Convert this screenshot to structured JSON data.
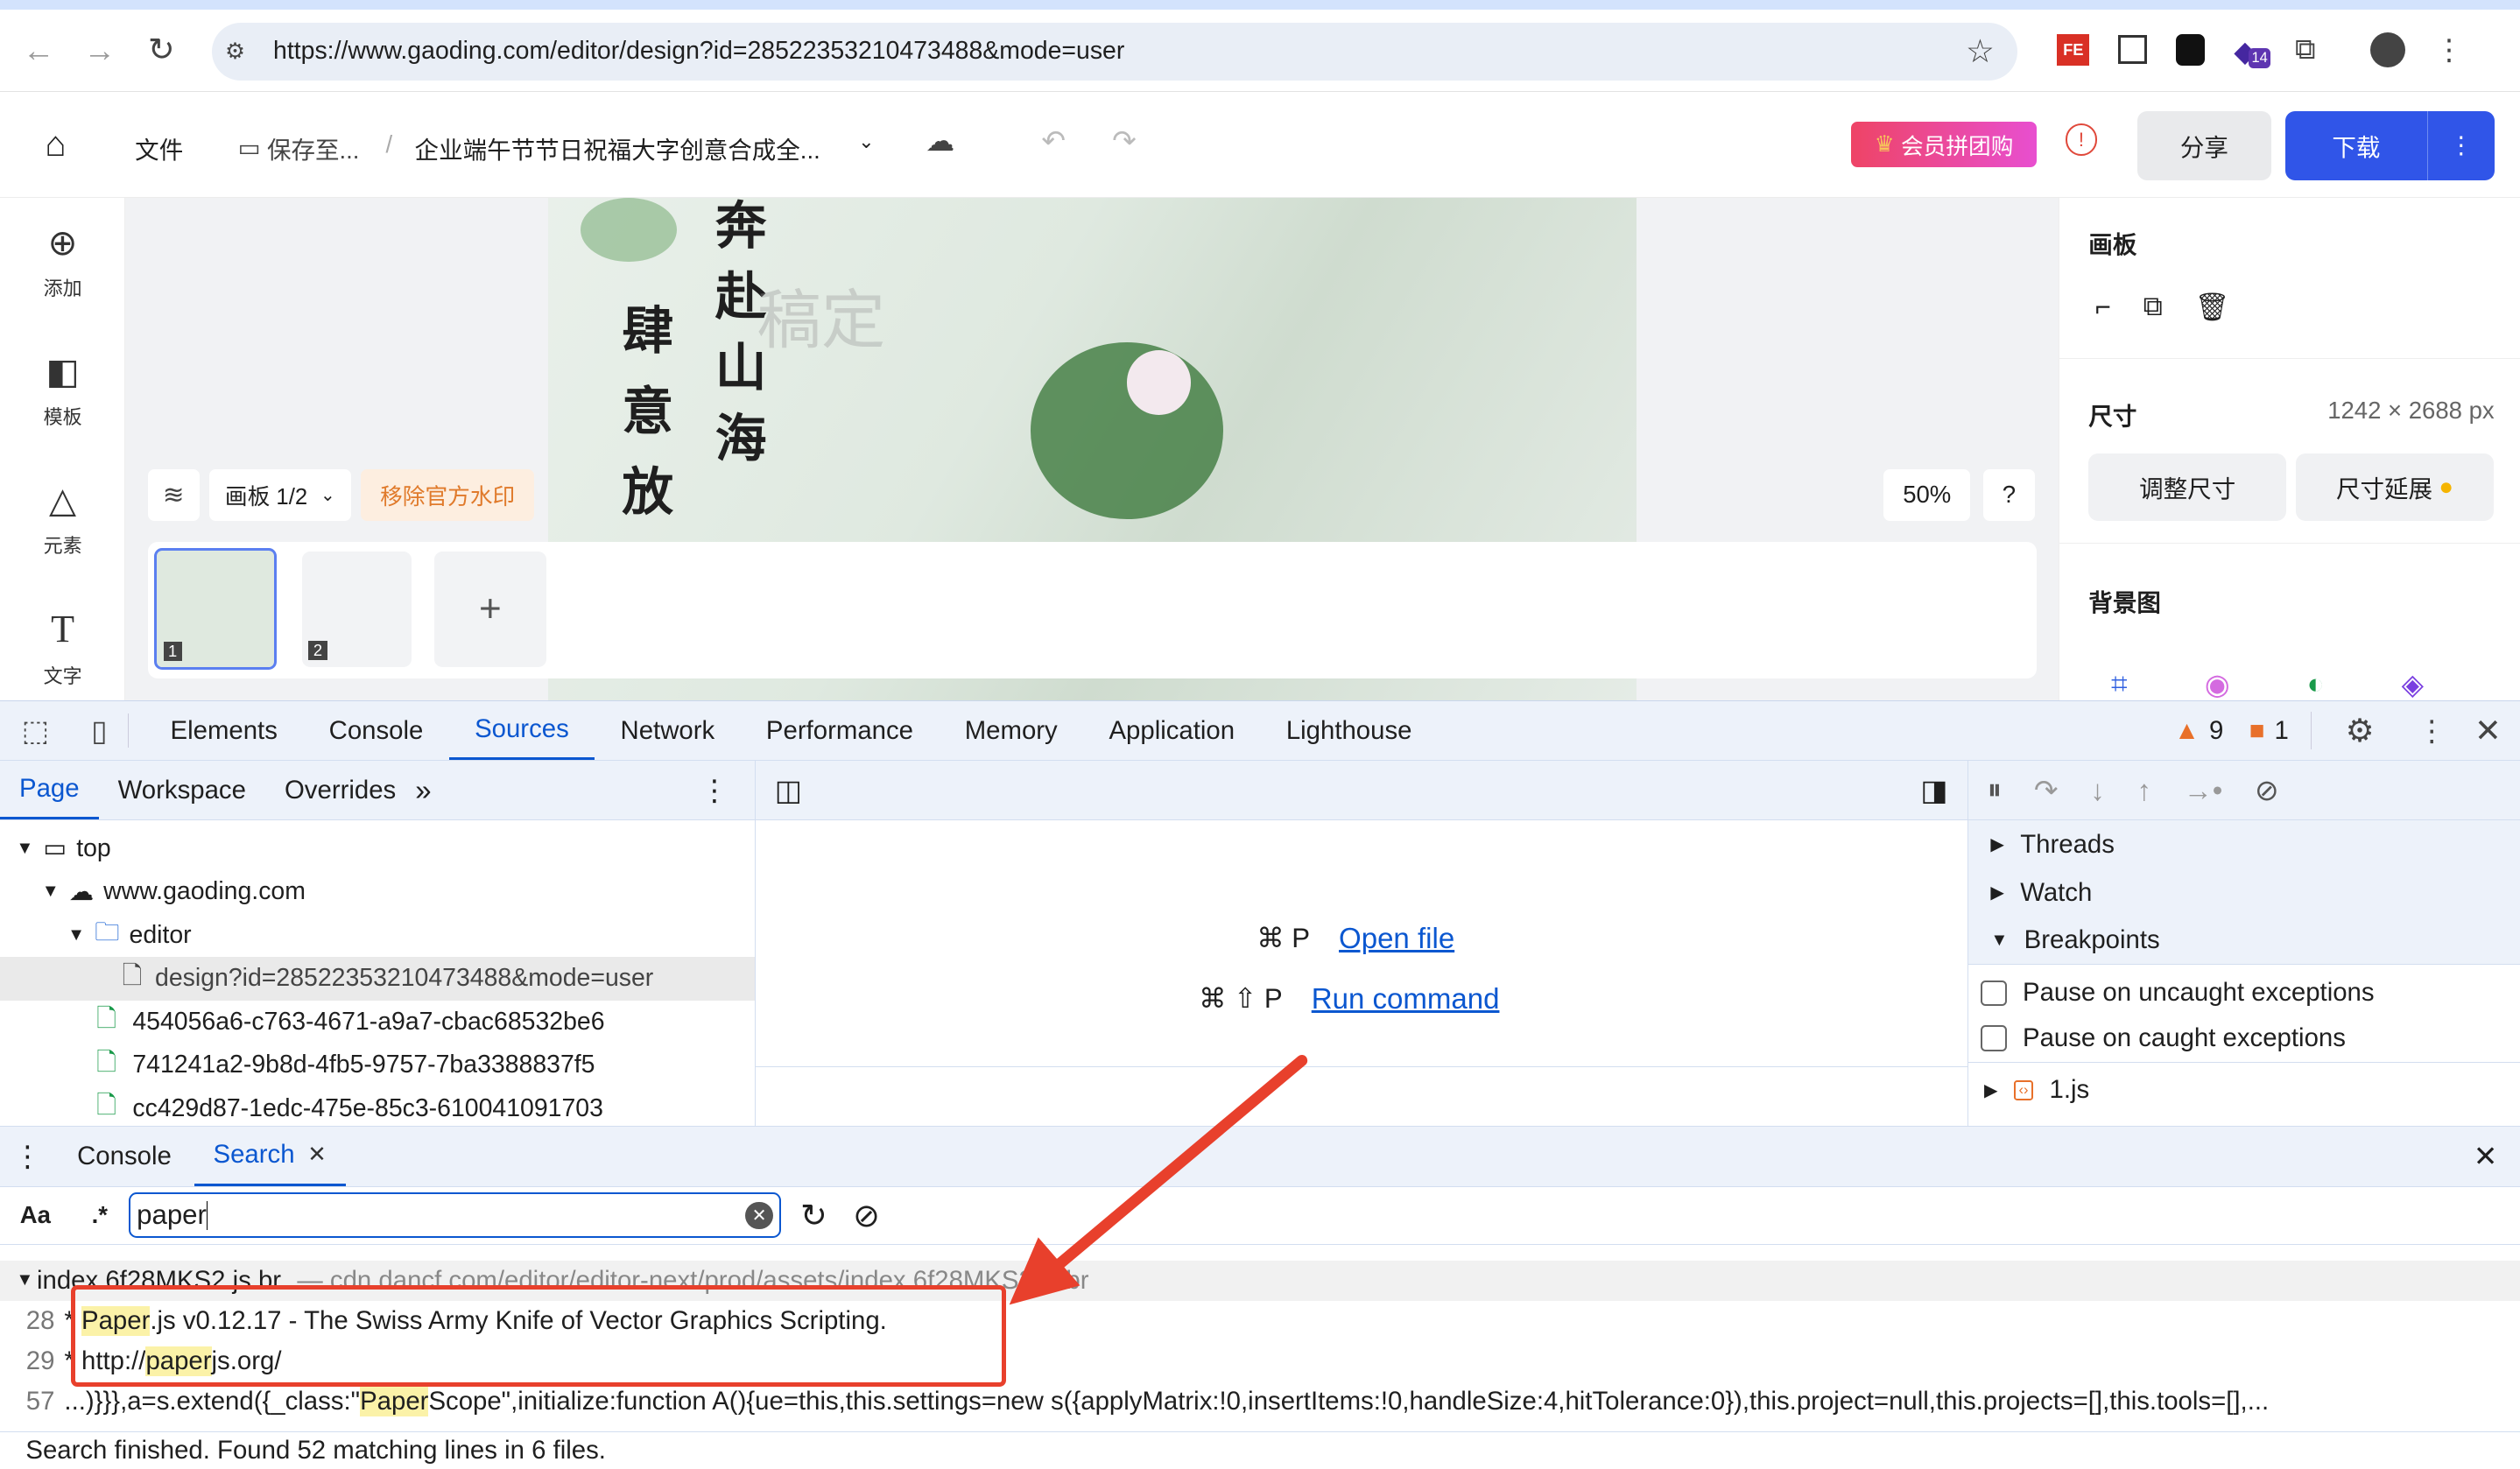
{
  "browser": {
    "url": "https://www.gaoding.com/editor/design?id=28522353210473488&mode=user",
    "ext_badge": "14"
  },
  "app": {
    "file_menu": "文件",
    "save_to": "保存至...",
    "separator": "/",
    "doc_title": "企业端午节节日祝福大字创意合成全...",
    "vip_button": "会员拼团购",
    "share": "分享",
    "download": "下载"
  },
  "sidebar": {
    "items": [
      {
        "label": "添加",
        "icon": "plus-circle-icon"
      },
      {
        "label": "模板",
        "icon": "template-icon"
      },
      {
        "label": "元素",
        "icon": "shapes-icon"
      },
      {
        "label": "文字",
        "icon": "text-icon"
      }
    ]
  },
  "canvas": {
    "board_label": "画板 1/2",
    "remove_watermark": "移除官方水印",
    "zoom": "50%",
    "help": "?",
    "poster_text": [
      "奔",
      "赴",
      "山",
      "海",
      "肆",
      "意",
      "放"
    ],
    "watermark": "稿定",
    "thumbnails": [
      "1",
      "2"
    ],
    "add": "+"
  },
  "right_panel": {
    "section_board": "画板",
    "size_label": "尺寸",
    "size_value": "1242 × 2688 px",
    "resize": "调整尺寸",
    "extend": "尺寸延展",
    "background": "背景图"
  },
  "devtools": {
    "tabs": [
      "Elements",
      "Console",
      "Sources",
      "Network",
      "Performance",
      "Memory",
      "Application",
      "Lighthouse"
    ],
    "active_tab": "Sources",
    "warnings": "9",
    "errors": "1",
    "nav_tabs": [
      "Page",
      "Workspace",
      "Overrides"
    ],
    "tree": [
      "top",
      "www.gaoding.com",
      "editor",
      "design?id=28522353210473488&mode=user",
      "454056a6-c763-4671-a9a7-cbac68532be6",
      "741241a2-9b8d-4fb5-9757-7ba3388837f5",
      "cc429d87-1edc-475e-85c3-610041091703"
    ],
    "editor": {
      "open_shortcut": "⌘ P",
      "open_file": "Open file",
      "run_shortcut": "⌘ ⇧ P",
      "run_command": "Run command"
    },
    "debugger": {
      "sections": [
        "Threads",
        "Watch",
        "Breakpoints"
      ],
      "pause_uncaught": "Pause on uncaught exceptions",
      "pause_caught": "Pause on caught exceptions",
      "file": "1.js"
    },
    "drawer_tabs": [
      "Console",
      "Search"
    ],
    "search": {
      "case_label": "Aa",
      "regex_label": ".*",
      "query": "paper"
    },
    "results": {
      "file": "index.6f28MKS2.js.br",
      "path": "— cdn.dancf.com/editor/editor-next/prod/assets/index.6f28MKS2.js.br",
      "lines": [
        {
          "n": "28",
          "pre": "* ",
          "hl": "Paper",
          "post": ".js v0.12.17 - The Swiss Army Knife of Vector Graphics Scripting."
        },
        {
          "n": "29",
          "pre": "* http://",
          "hl": "paper",
          "post": "js.org/"
        },
        {
          "n": "57",
          "pre": "...)}}},a=s.extend({_class:\"",
          "hl": "Paper",
          "post": "Scope\",initialize:function A(){ue=this,this.settings=new s({applyMatrix:!0,insertItems:!0,handleSize:4,hitTolerance:0}),this.project=null,this.projects=[],this.tools=[],..."
        }
      ]
    },
    "status": "Search finished.  Found 52 matching lines in 6 files."
  },
  "colors": {
    "accent": "#0b57d0",
    "download": "#3055e8",
    "annotation": "#e8402c",
    "highlight": "#fbf2a8"
  }
}
